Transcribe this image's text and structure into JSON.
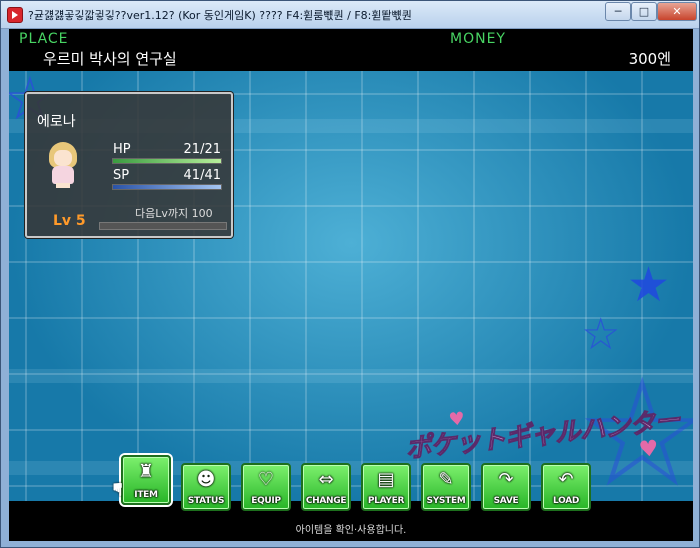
{
  "window": {
    "title": "?귣걣걣곻깋깗귛깋??ver1.12?  (Kor 동인게임K) ???? F4:휟룸뺷퀀 / F8:휟뙅뺷퀀",
    "min_label": "─",
    "max_label": "□",
    "close_label": "✕"
  },
  "topbar": {
    "place_label": "PLACE",
    "place_name": "우르미 박사의 연구실",
    "money_label": "MONEY",
    "money_value": "300엔"
  },
  "status": {
    "name": "에로나",
    "hp_label": "HP",
    "hp_value": "21/21",
    "hp_fraction": 1.0,
    "sp_label": "SP",
    "sp_value": "41/41",
    "sp_fraction": 1.0,
    "level": "Lv 5",
    "next_level": "다음Lv까지 100",
    "exp_fraction": 0.0
  },
  "logo_text": "ポケットギャルハンター",
  "menu": [
    {
      "label": "ITEM",
      "icon": "bag-icon",
      "glyph": "♜"
    },
    {
      "label": "STATUS",
      "icon": "person-icon",
      "glyph": "☻"
    },
    {
      "label": "EQUIP",
      "icon": "bikini-icon",
      "glyph": "♡"
    },
    {
      "label": "CHANGE",
      "icon": "swap-arrows-icon",
      "glyph": "⇔"
    },
    {
      "label": "PLAYER",
      "icon": "card-icon",
      "glyph": "▤"
    },
    {
      "label": "SYSTEM",
      "icon": "wrench-icon",
      "glyph": "✎"
    },
    {
      "label": "SAVE",
      "icon": "save-arrow-icon",
      "glyph": "↷"
    },
    {
      "label": "LOAD",
      "icon": "load-arrow-icon",
      "glyph": "↶"
    }
  ],
  "help_text": "아이템을 확인·사용합니다.",
  "colors": {
    "label_green": "#48d463",
    "button_green": "#3cc93a",
    "level_orange": "#ff9a2a"
  }
}
